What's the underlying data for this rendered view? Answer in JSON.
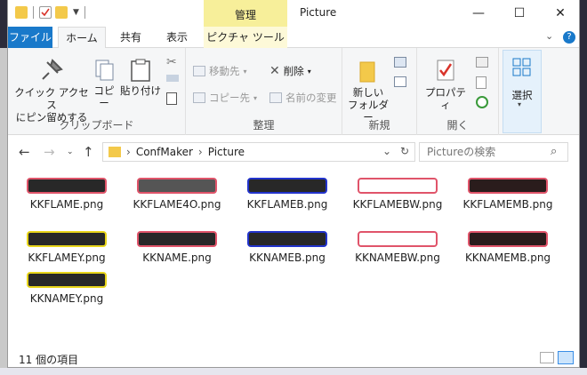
{
  "window": {
    "title": "Picture",
    "context_tab": "管理",
    "min_glyph": "—",
    "max_glyph": "☐",
    "close_glyph": "✕"
  },
  "menu": {
    "file": "ファイル",
    "home": "ホーム",
    "share": "共有",
    "view": "表示",
    "picture_tools": "ピクチャ ツール"
  },
  "ribbon": {
    "quick_access": "クイック アクセス\nにピン留めする",
    "copy": "コピー",
    "paste": "貼り付け",
    "clipboard": "クリップボード",
    "move_to": "移動先",
    "copy_to": "コピー先",
    "delete": "削除",
    "rename": "名前の変更",
    "organize": "整理",
    "new_folder": "新しい\nフォルダー",
    "new": "新規",
    "properties": "プロパティ",
    "open": "開く",
    "select": "選択"
  },
  "address": {
    "crumbs": [
      "ConfMaker",
      "Picture"
    ],
    "search_placeholder": "Pictureの検索"
  },
  "files": [
    {
      "name": "KKFLAME.png",
      "fill": "#282828",
      "border": "#e0546a"
    },
    {
      "name": "KKFLAME4O.png",
      "fill": "#555555",
      "border": "#e0546a"
    },
    {
      "name": "KKFLAMEB.png",
      "fill": "#282828",
      "border": "#2233cc"
    },
    {
      "name": "KKFLAMEBW.png",
      "fill": "#ffffff",
      "border": "#e0546a"
    },
    {
      "name": "KKFLAMEMB.png",
      "fill": "#2a1c1c",
      "border": "#e0546a"
    },
    {
      "name": "KKFLAMEY.png",
      "fill": "#282828",
      "border": "#e8d51a"
    },
    {
      "name": "KKNAME.png",
      "fill": "#282828",
      "border": "#e0546a"
    },
    {
      "name": "KKNAMEB.png",
      "fill": "#282828",
      "border": "#2233cc"
    },
    {
      "name": "KKNAMEBW.png",
      "fill": "#ffffff",
      "border": "#e0546a"
    },
    {
      "name": "KKNAMEMB.png",
      "fill": "#2a1c1c",
      "border": "#e0546a"
    },
    {
      "name": "KKNAMEY.png",
      "fill": "#282828",
      "border": "#e8d51a"
    }
  ],
  "status": {
    "count": "11 個の項目"
  },
  "colors": {
    "accent": "#1979ca",
    "context_tab": "#f7ef9a"
  }
}
